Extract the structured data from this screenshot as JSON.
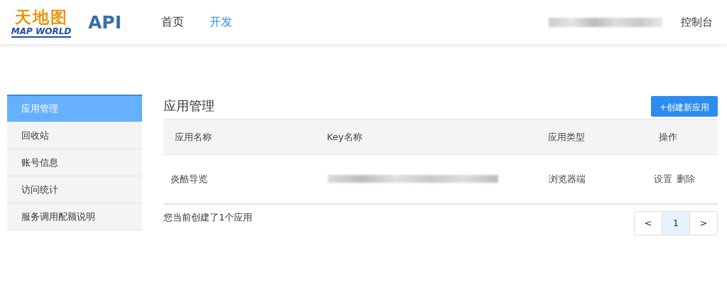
{
  "header": {
    "logo": {
      "chinese": "天地图",
      "english": "MAP WORLD"
    },
    "product": "API",
    "nav": [
      {
        "label": "首页",
        "selected": false
      },
      {
        "label": "开发",
        "selected": true
      }
    ],
    "console_link": "控制台"
  },
  "sidebar": {
    "items": [
      {
        "label": "应用管理",
        "selected": true
      },
      {
        "label": "回收站",
        "selected": false
      },
      {
        "label": "账号信息",
        "selected": false
      },
      {
        "label": "访问统计",
        "selected": false
      },
      {
        "label": "服务调用配额说明",
        "selected": false
      }
    ]
  },
  "main": {
    "title": "应用管理",
    "create_button": "+创建新应用",
    "table": {
      "columns": [
        "应用名称",
        "Key名称",
        "应用类型",
        "操作"
      ],
      "rows": [
        {
          "name": "炎酷导览",
          "type": "浏览器端",
          "actions": [
            "设置",
            "删除"
          ]
        }
      ]
    },
    "summary": "您当前创建了1个应用",
    "pagination": {
      "prev": "<",
      "pages": [
        {
          "label": "1",
          "selected": true
        }
      ],
      "next": ">"
    }
  }
}
